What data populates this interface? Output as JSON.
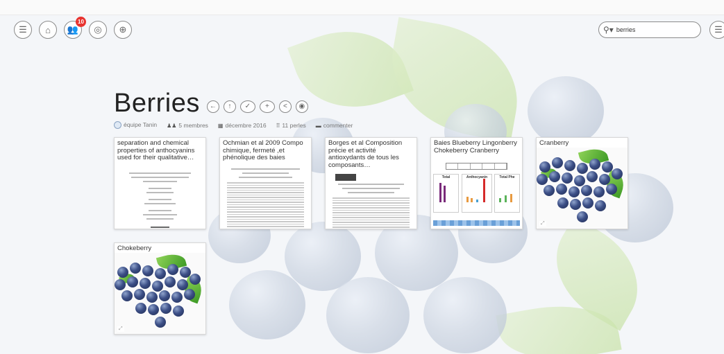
{
  "nav": {
    "notifications_count": "10"
  },
  "search": {
    "value": "berries"
  },
  "board": {
    "title": "Berries",
    "owner": "équipe Tanin",
    "members": "5 membres",
    "date": "décembre 2016",
    "pearls": "11 perles",
    "comment": "commenter"
  },
  "cards": [
    {
      "title": "separation and chemical properties of anthocyanins used for their qualitative…"
    },
    {
      "title": "Ochmian et al 2009 Compo chimique, fermeté ,et phénolique des baies"
    },
    {
      "title": "Borges et al Composition précie et activité antioxydants de tous les composants…"
    },
    {
      "title": "Baies Blueberry Lingonberry Chokeberry Cranberry"
    },
    {
      "title": "Cranberry"
    },
    {
      "title": "Chokeberry"
    }
  ],
  "chart_panels": [
    "Total",
    "Anthocyanin",
    "Total Phe"
  ],
  "colors": {
    "badge": "#e8332f",
    "berry": "#3c4f86",
    "leaf": "#3d9a25"
  }
}
